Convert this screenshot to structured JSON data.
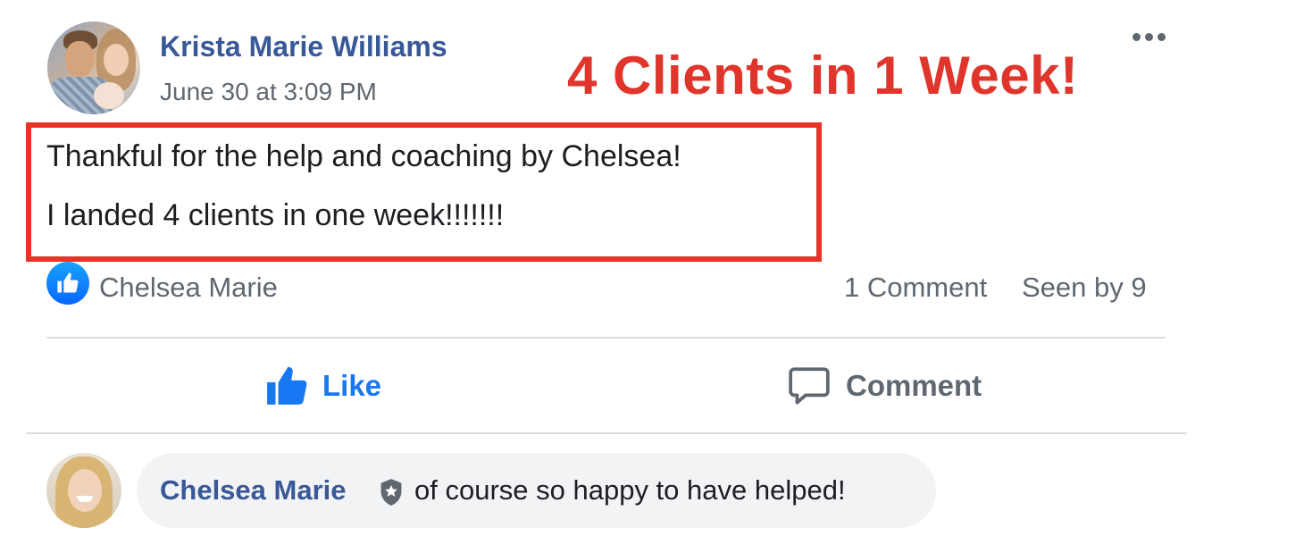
{
  "post": {
    "author": "Krista Marie Williams",
    "timestamp": "June 30 at 3:09 PM",
    "headline": "4 Clients in 1 Week!",
    "body_lines": [
      "Thankful for the help and coaching by Chelsea!",
      "I landed 4 clients in one week!!!!!!!"
    ],
    "reactor": "Chelsea Marie",
    "comment_count": "1 Comment",
    "seen_by": "Seen by 9"
  },
  "actions": {
    "like_label": "Like",
    "comment_label": "Comment"
  },
  "comment": {
    "author": "Chelsea Marie",
    "text": "of course so happy to have helped!"
  },
  "icons": [
    "more-options-icon",
    "like-reaction-icon",
    "thumbs-up-icon",
    "speech-bubble-icon",
    "admin-badge-icon"
  ],
  "colors": {
    "name_blue": "#385898",
    "like_blue": "#1877f2",
    "highlight_red": "#e53528",
    "headline_red": "#e0352b",
    "muted_gray": "#606770"
  }
}
